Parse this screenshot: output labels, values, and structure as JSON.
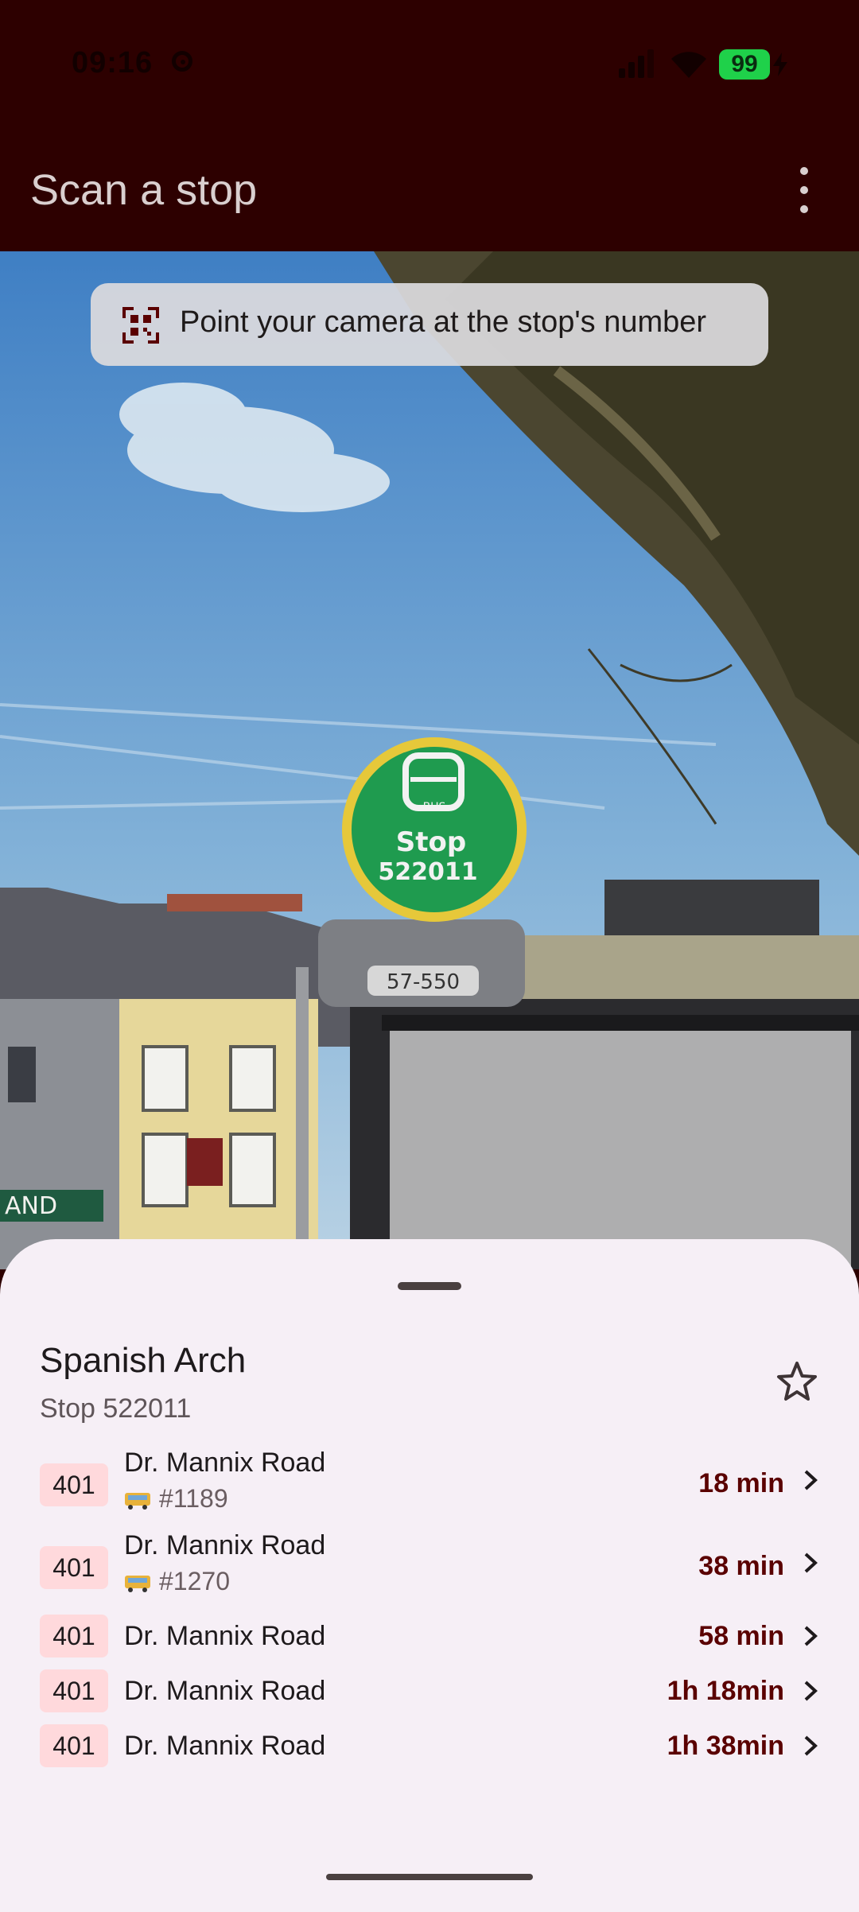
{
  "status_bar": {
    "time": "09:16",
    "battery": "99"
  },
  "app_bar": {
    "title": "Scan a stop",
    "menu_icon": "more-vert-icon"
  },
  "camera": {
    "hint": "Point your camera at the stop's number",
    "hint_icon": "qr-scan-icon",
    "sign_label": "BUS",
    "sign_stop_word": "Stop",
    "sign_number": "522011",
    "plate_text": "57-550",
    "shop_text": "AND"
  },
  "stop": {
    "name": "Spanish Arch",
    "code": "Stop 522011",
    "favorite_icon": "star-outline-icon"
  },
  "arrivals": [
    {
      "route": "401",
      "destination": "Dr. Mannix Road",
      "vehicle": "#1189",
      "eta": "18 min"
    },
    {
      "route": "401",
      "destination": "Dr. Mannix Road",
      "vehicle": "#1270",
      "eta": "38 min"
    },
    {
      "route": "401",
      "destination": "Dr. Mannix Road",
      "vehicle": "",
      "eta": "58 min"
    },
    {
      "route": "401",
      "destination": "Dr. Mannix Road",
      "vehicle": "",
      "eta": "1h 18min"
    },
    {
      "route": "401",
      "destination": "Dr. Mannix Road",
      "vehicle": "",
      "eta": "1h 38min"
    }
  ],
  "colors": {
    "app_bar": "#2d0000",
    "sheet": "#f6eff6",
    "badge": "#ffd9dc",
    "eta": "#5a0000",
    "battery": "#1fd14a"
  }
}
